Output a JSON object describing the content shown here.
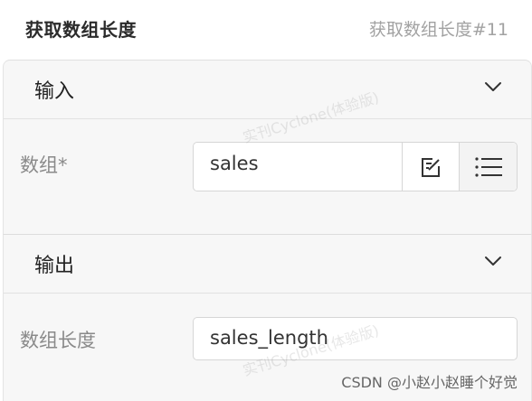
{
  "header": {
    "title": "获取数组长度",
    "node_id": "获取数组长度#11"
  },
  "input_section": {
    "title": "输入",
    "field_label": "数组*",
    "field_value": "sales"
  },
  "output_section": {
    "title": "输出",
    "field_label": "数组长度",
    "field_value": "sales_length"
  },
  "watermark": "实刊Cyclone(体验版)",
  "footer_credit": "CSDN @小赵小赵睡个好觉",
  "icons": {
    "collapse": "chevron-down-icon",
    "edit": "edit-icon",
    "list": "list-icon"
  }
}
